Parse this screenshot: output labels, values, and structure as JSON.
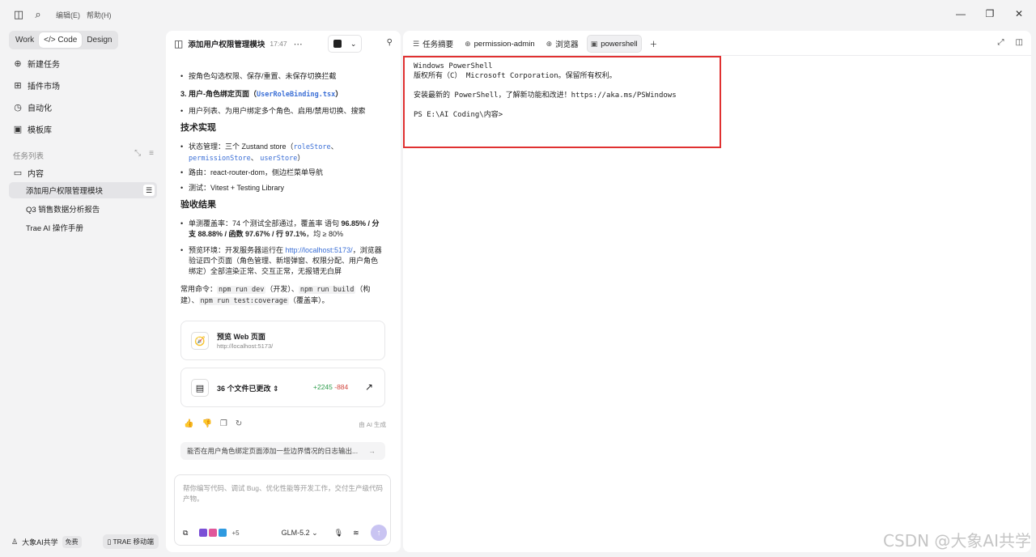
{
  "menu": {
    "edit": "编辑(E)",
    "help": "帮助(H)"
  },
  "modes": [
    "Work",
    "Code",
    "Design"
  ],
  "nav": {
    "new_task": "新建任务",
    "plugins": "插件市场",
    "automation": "自动化",
    "templates": "模板库"
  },
  "tasks": {
    "section_title": "任务列表",
    "folder": "内容",
    "items": [
      "添加用户权限管理模块",
      "Q3 销售数据分析报告",
      "Trae AI 操作手册"
    ]
  },
  "footer": {
    "user": "大象AI共学",
    "plan": "免费",
    "mobile": "TRAE 移动端"
  },
  "chat": {
    "title": "添加用户权限管理模块",
    "time": "17:47",
    "lines": {
      "b1": "按角色勾选权限、保存/重置、未保存切换拦截",
      "sec3_prefix": "3. 用户-角色绑定页面（",
      "sec3_code": "UserRoleBinding.tsx",
      "sec3_suffix": "）",
      "b2": "用户列表、为用户绑定多个角色、启用/禁用切换、搜索",
      "h_tech": "技术实现",
      "state_prefix": "状态管理：三个 Zustand store（",
      "store1": "roleStore",
      "sep": "、",
      "store2": "permissionStore",
      "store3": "userStore",
      "close": "）",
      "router": "路由：react-router-dom，侧边栏菜单导航",
      "test": "测试：Vitest + Testing Library",
      "h_result": "验收结果",
      "coverage_a": "单测覆盖率：74 个测试全部通过，覆盖率 语句 ",
      "coverage_b": "96.85% / 分支 88.88% / 函数 97.67% / 行 97.1%",
      "coverage_c": "，均 ≥ 80%",
      "preview_a": "预览环境：开发服务器运行在 ",
      "preview_link": "http://localhost:5173/",
      "preview_b": "，浏览器验证四个页面（角色管理、新增弹窗、权限分配、用户角色绑定）全部渲染正常、交互正常，无报错无白屏",
      "cmd_label": "常用命令：",
      "cmd1": "npm run dev",
      "cmd1_note": "（开发）、",
      "cmd2": "npm run build",
      "cmd2_note": "（构建）、",
      "cmd3": "npm run test:coverage",
      "cmd3_note": "（覆盖率）。"
    },
    "preview_card": {
      "title": "预览 Web 页面",
      "url": "http://localhost:5173/"
    },
    "files_card": {
      "title": "36 个文件已更改",
      "added": "+2245",
      "removed": "-884"
    },
    "ai_tag": "由 AI 生成",
    "suggestion": "能否在用户角色绑定页面添加一些边界情况的日志输出...",
    "composer_placeholder": "帮你编写代码、调试 Bug、优化性能等开发工作，交付生产级代码产物。",
    "more_apps": "+5",
    "model": "GLM-5.2"
  },
  "tabs": [
    "任务摘要",
    "permission-admin",
    "浏览器",
    "powershell"
  ],
  "terminal": {
    "text": "Windows PowerShell\n版权所有（C） Microsoft Corporation。保留所有权利。\n\n安装最新的 PowerShell，了解新功能和改进！https://aka.ms/PSWindows\n\nPS E:\\AI Coding\\内容>"
  },
  "watermark": "CSDN @大象AI共学"
}
